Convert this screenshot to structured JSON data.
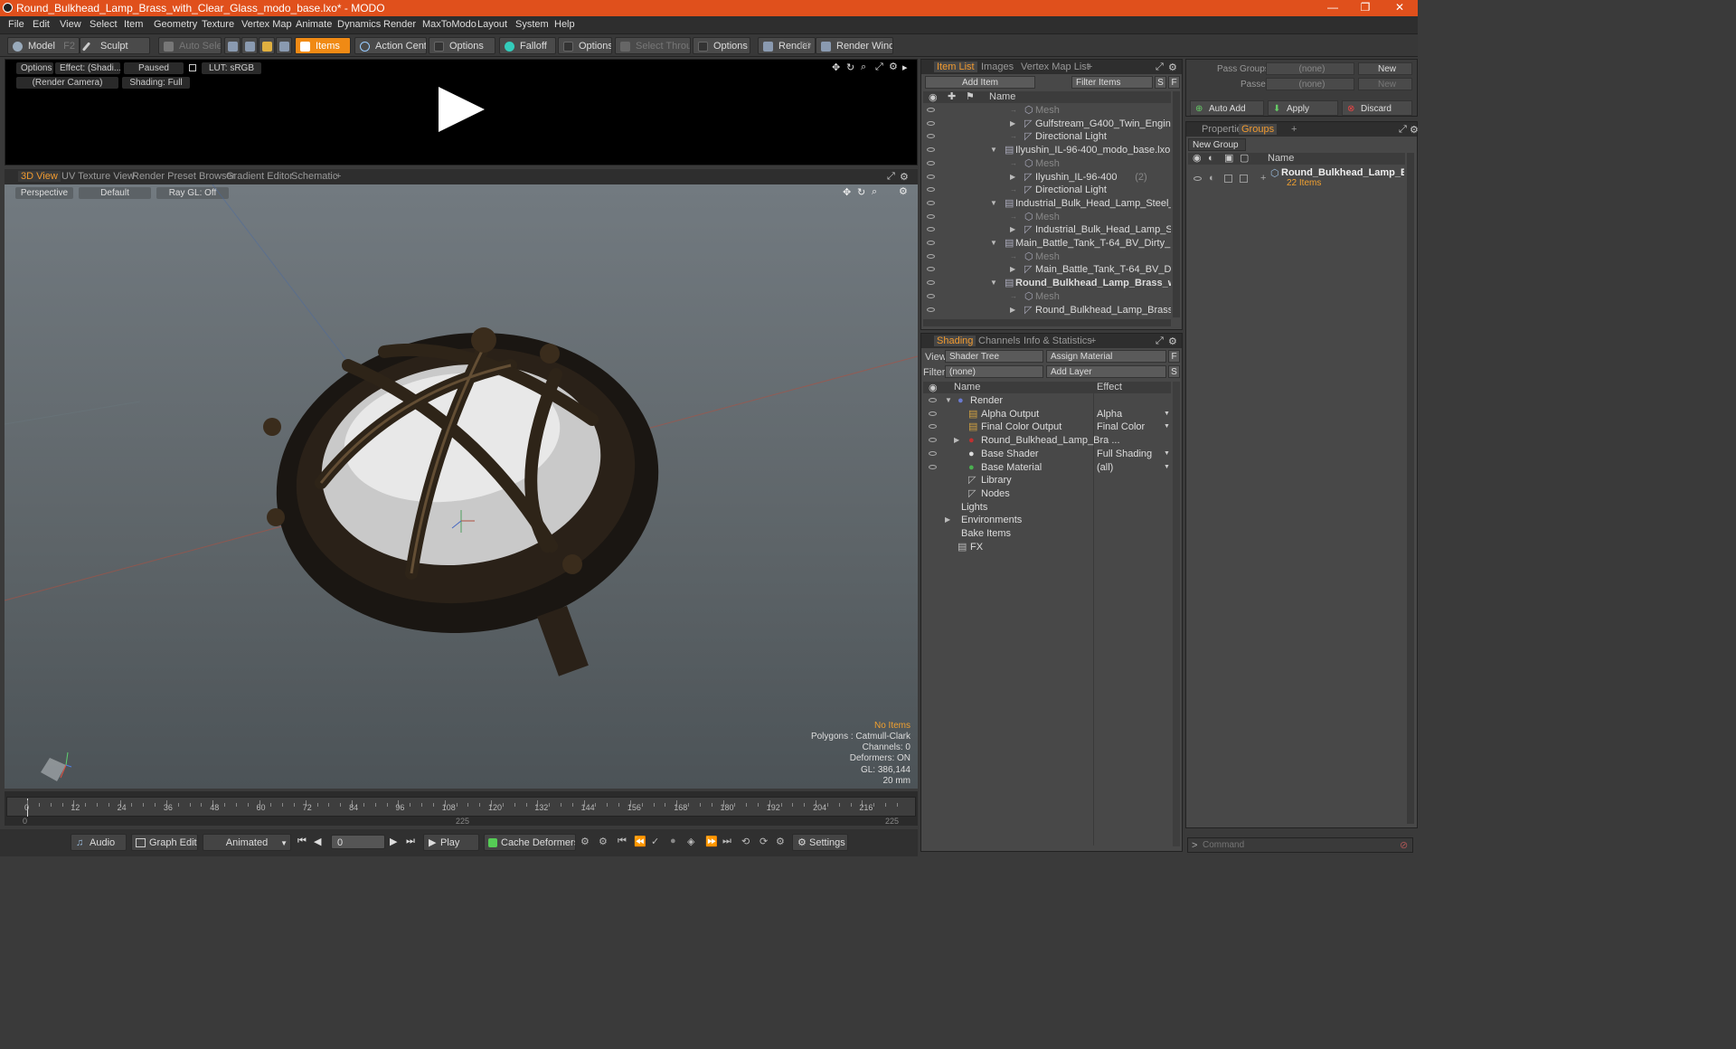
{
  "window": {
    "title": "Round_Bulkhead_Lamp_Brass_with_Clear_Glass_modo_base.lxo* - MODO",
    "minimize": "—",
    "maximize": "❐",
    "close": "✕"
  },
  "menu": [
    "File",
    "Edit",
    "View",
    "Select",
    "Item",
    "Geometry",
    "Texture",
    "Vertex Map",
    "Animate",
    "Dynamics",
    "Render",
    "MaxToModo",
    "Layout",
    "System",
    "Help"
  ],
  "toolbar": {
    "model": "Model",
    "model_key": "F2",
    "sculpt": "Sculpt",
    "auto_select": "Auto Select",
    "items": "Items",
    "action_center": "Action Center",
    "options1": "Options",
    "falloff": "Falloff",
    "options2": "Options",
    "select_through": "Select Through",
    "options3": "Options",
    "render": "Render",
    "render_key": "F9",
    "render_window": "Render Window"
  },
  "render_pane": {
    "options": "Options",
    "effect": "Effect: (Shadi...",
    "paused": "Paused",
    "lut": "LUT: sRGB",
    "camera": "(Render Camera)",
    "shading": "Shading: Full"
  },
  "view_tabs": [
    "3D View",
    "UV Texture View",
    "Render Preset Browser",
    "Gradient Editor",
    "Schematic"
  ],
  "viewport": {
    "perspective": "Perspective",
    "default": "Default",
    "raygl": "Ray GL: Off",
    "info": {
      "no_items": "No Items",
      "polygons": "Polygons : Catmull-Clark",
      "channels": "Channels: 0",
      "deformers": "Deformers: ON",
      "gl": "GL: 386,144",
      "scale": "20 mm"
    }
  },
  "timeline": {
    "ticks": [
      "0",
      "12",
      "24",
      "36",
      "48",
      "60",
      "72",
      "84",
      "96",
      "108",
      "120",
      "132",
      "144",
      "156",
      "168",
      "180",
      "192",
      "204",
      "216"
    ],
    "start": "0",
    "mid": "225",
    "end": "225"
  },
  "transport": {
    "audio": "Audio",
    "graph_editor": "Graph Editor",
    "animated": "Animated",
    "frame": "0",
    "play": "Play",
    "cache": "Cache Deformers",
    "settings": "Settings"
  },
  "item_list": {
    "tabs": [
      "Item List",
      "Images",
      "Vertex Map List"
    ],
    "add_item": "Add Item",
    "filter": "Filter Items",
    "s_btn": "S",
    "f_btn": "F",
    "col_name": "Name",
    "rows": [
      {
        "label": "Mesh",
        "indent": 2,
        "dim": true
      },
      {
        "label": "Gulfstream_G400_Twin_Engine_Business...",
        "indent": 2,
        "expand": true
      },
      {
        "label": "Directional Light",
        "indent": 2
      },
      {
        "label": "Ilyushin_IL-96-400_modo_base.lxo",
        "indent": 1,
        "open": true
      },
      {
        "label": "Mesh",
        "indent": 2,
        "dim": true
      },
      {
        "label": "Ilyushin_IL-96-400",
        "count": "(2)",
        "indent": 2,
        "expand": true
      },
      {
        "label": "Directional Light",
        "indent": 2
      },
      {
        "label": "Industrial_Bulk_Head_Lamp_Steel_with_Cl ...",
        "indent": 1,
        "open": true
      },
      {
        "label": "Mesh",
        "indent": 2,
        "dim": true
      },
      {
        "label": "Industrial_Bulk_Head_Lamp_Steel_with_...",
        "indent": 2,
        "expand": true
      },
      {
        "label": "Main_Battle_Tank_T-64_BV_Dirty_modo_b ...",
        "indent": 1,
        "open": true
      },
      {
        "label": "Mesh",
        "indent": 2,
        "dim": true
      },
      {
        "label": "Main_Battle_Tank_T-64_BV_Dirty",
        "count": "(2)",
        "indent": 2,
        "expand": true
      },
      {
        "label": "Round_Bulkhead_Lamp_Brass_with ...",
        "indent": 1,
        "open": true,
        "bold": true
      },
      {
        "label": "Mesh",
        "indent": 2,
        "dim": true
      },
      {
        "label": "Round_Bulkhead_Lamp_Brass_with_Cle ...",
        "indent": 2,
        "expand": true
      }
    ]
  },
  "shading": {
    "tabs": [
      "Shading",
      "Channels",
      "Info & Statistics"
    ],
    "view_label": "View",
    "view_value": "Shader Tree",
    "assign": "Assign Material",
    "f_btn": "F",
    "filter_label": "Filter",
    "filter_value": "(none)",
    "add_layer": "Add Layer",
    "s_btn": "S",
    "col_name": "Name",
    "col_effect": "Effect",
    "rows": [
      {
        "label": "Render",
        "effect": "",
        "indent": 0,
        "icon": "sphere"
      },
      {
        "label": "Alpha Output",
        "effect": "Alpha",
        "indent": 1,
        "icon": "output"
      },
      {
        "label": "Final Color Output",
        "effect": "Final Color",
        "indent": 1,
        "icon": "output"
      },
      {
        "label": "Round_Bulkhead_Lamp_Bra ...",
        "effect": "",
        "indent": 1,
        "icon": "material"
      },
      {
        "label": "Base Shader",
        "effect": "Full Shading",
        "indent": 1,
        "icon": "shader"
      },
      {
        "label": "Base Material",
        "effect": "(all)",
        "indent": 1,
        "icon": "basemat"
      },
      {
        "label": "Library",
        "effect": "",
        "indent": 1,
        "icon": "folder"
      },
      {
        "label": "Nodes",
        "effect": "",
        "indent": 1,
        "icon": "folder"
      },
      {
        "label": "Lights",
        "effect": "",
        "indent": 0
      },
      {
        "label": "Environments",
        "effect": "",
        "indent": 0
      },
      {
        "label": "Bake Items",
        "effect": "",
        "indent": 0
      },
      {
        "label": "FX",
        "effect": "",
        "indent": 0,
        "icon": "fx"
      }
    ]
  },
  "groups": {
    "pass_groups_label": "Pass Groups",
    "pass_groups_value": "(none)",
    "new1": "New",
    "passes_label": "Passes",
    "passes_value": "(none)",
    "new2": "New",
    "auto_add": "Auto Add",
    "apply": "Apply",
    "discard": "Discard",
    "tabs": [
      "Properties",
      "Groups"
    ],
    "new_group": "New Group",
    "col_name": "Name",
    "item_name": "Round_Bulkhead_Lamp_Br...",
    "item_count": "22 Items"
  },
  "command_placeholder": "Command",
  "colors": {
    "accent": "#f09a30",
    "titlebar": "#e0501c"
  }
}
